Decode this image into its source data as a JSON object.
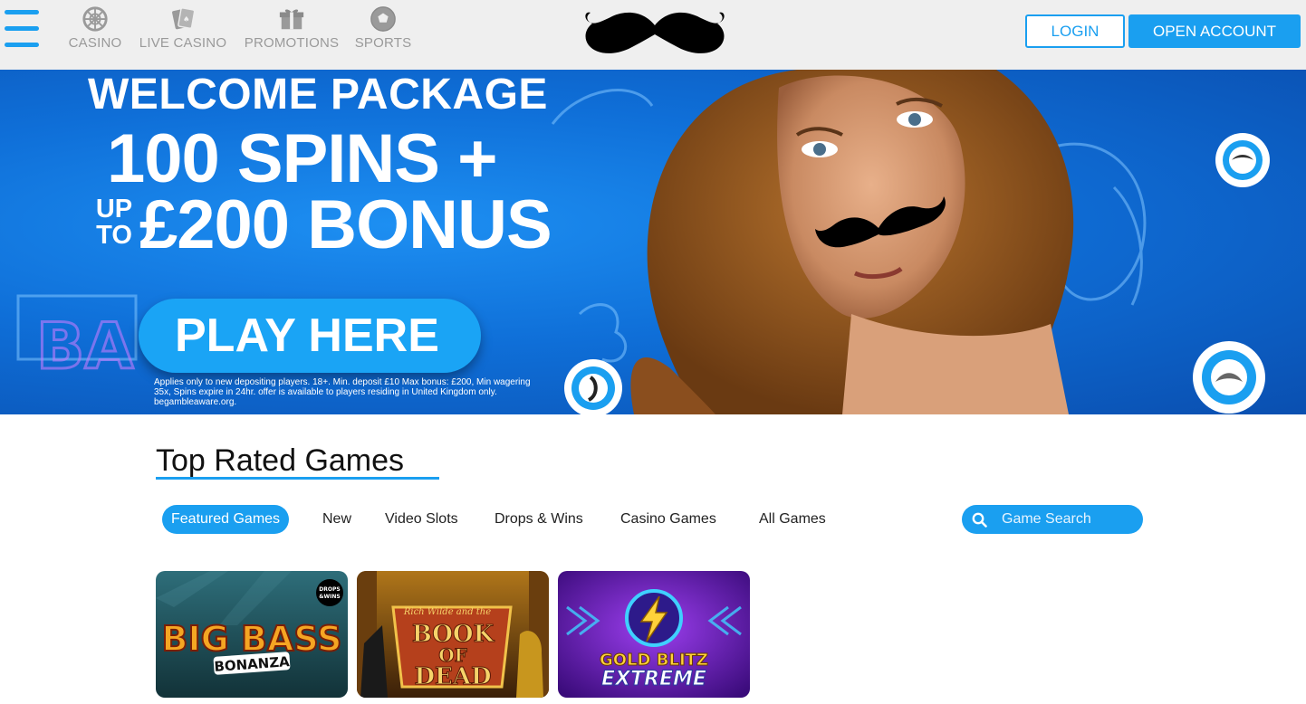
{
  "nav": {
    "menu_icon": "hamburger-menu-icon",
    "items": [
      {
        "label": "CASINO",
        "icon": "roulette-wheel-icon"
      },
      {
        "label": "LIVE CASINO",
        "icon": "playing-cards-icon"
      },
      {
        "label": "PROMOTIONS",
        "icon": "gift-box-icon"
      },
      {
        "label": "SPORTS",
        "icon": "football-icon"
      }
    ],
    "logo": "moustache-logo",
    "login_label": "LOGIN",
    "open_account_label": "OPEN ACCOUNT"
  },
  "hero": {
    "line1": "WELCOME PACKAGE",
    "line2": "100 SPINS +",
    "upto_top": "UP",
    "upto_bottom": "TO",
    "line3": "£200 BONUS",
    "cta_label": "PLAY HERE",
    "terms": "Applies only to new depositing players. 18+. Min. deposit £10 Max bonus: £200, Min wagering 35x, Spins expire in 24hr. offer is available to players residing in United Kingdom only. begambleaware.org."
  },
  "games": {
    "title": "Top Rated Games",
    "tabs": [
      "Featured Games",
      "New",
      "Video Slots",
      "Drops & Wins",
      "Casino Games",
      "All Games"
    ],
    "active_tab": "Featured Games",
    "search_placeholder": "Game Search",
    "tiles": [
      {
        "name": "BIG BASS BONANZA",
        "line1": "BIG BASS",
        "line2": "BONANZA",
        "badge_top": "DROPS",
        "badge_bottom": "&WINS"
      },
      {
        "name": "BOOK OF DEAD",
        "subtitle": "Rich Wilde and the",
        "line1": "BOOK",
        "line2": "OF",
        "line3": "DEAD"
      },
      {
        "name": "GOLD BLITZ EXTREME",
        "line1": "GOLD BLITZ",
        "line2": "EXTREME"
      }
    ]
  },
  "colors": {
    "accent": "#1a9ff0",
    "header_bg": "#efefef",
    "nav_grey": "#9a9a9a"
  }
}
